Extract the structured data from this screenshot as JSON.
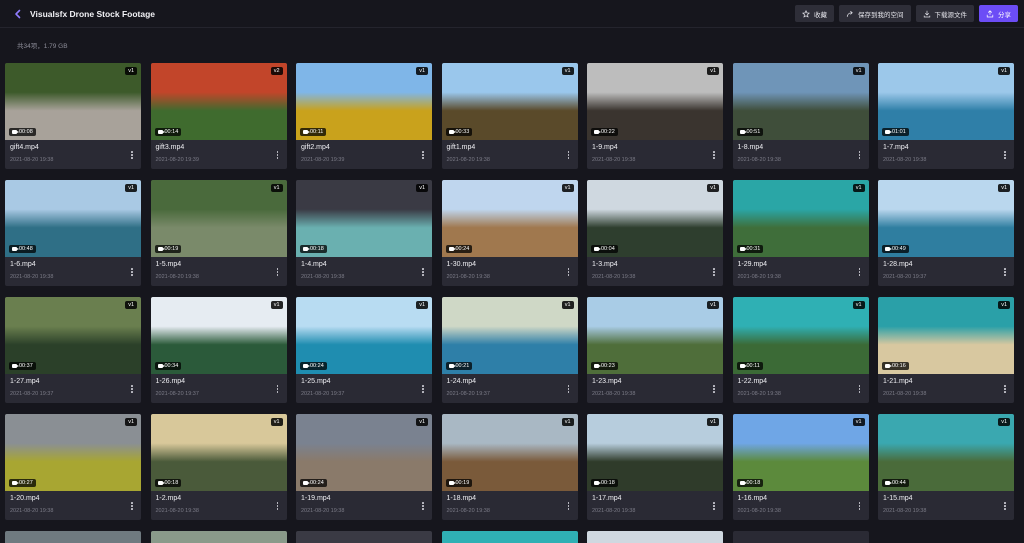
{
  "header": {
    "title": "Visualsfx Drone Stock Footage",
    "actions": [
      {
        "label": "收藏",
        "icon": "star-icon"
      },
      {
        "label": "保存到我的空间",
        "icon": "share-arrow-icon"
      },
      {
        "label": "下载源文件",
        "icon": "download-icon"
      },
      {
        "label": "分享",
        "icon": "share-icon"
      }
    ]
  },
  "meta": {
    "summary": "共34项，1.79 GB"
  },
  "videos": [
    {
      "name": "gift4.mp4",
      "date": "2021-08-20 19:38",
      "duration": "00:08",
      "version": "v1"
    },
    {
      "name": "gift3.mp4",
      "date": "2021-08-20 19:39",
      "duration": "00:14",
      "version": "v2"
    },
    {
      "name": "gift2.mp4",
      "date": "2021-08-20 19:39",
      "duration": "00:11",
      "version": "v1"
    },
    {
      "name": "gift1.mp4",
      "date": "2021-08-20 19:38",
      "duration": "00:33",
      "version": "v1"
    },
    {
      "name": "1-9.mp4",
      "date": "2021-08-20 19:38",
      "duration": "00:22",
      "version": "v1"
    },
    {
      "name": "1-8.mp4",
      "date": "2021-08-20 19:38",
      "duration": "00:51",
      "version": "v1"
    },
    {
      "name": "1-7.mp4",
      "date": "2021-08-20 19:38",
      "duration": "01:01",
      "version": "v1"
    },
    {
      "name": "1-6.mp4",
      "date": "2021-08-20 19:38",
      "duration": "00:48",
      "version": "v1"
    },
    {
      "name": "1-5.mp4",
      "date": "2021-08-20 19:38",
      "duration": "00:19",
      "version": "v1"
    },
    {
      "name": "1-4.mp4",
      "date": "2021-08-20 19:38",
      "duration": "00:18",
      "version": "v1"
    },
    {
      "name": "1-30.mp4",
      "date": "2021-08-20 19:38",
      "duration": "00:24",
      "version": "v1"
    },
    {
      "name": "1-3.mp4",
      "date": "2021-08-20 19:38",
      "duration": "00:04",
      "version": "v1"
    },
    {
      "name": "1-29.mp4",
      "date": "2021-08-20 19:38",
      "duration": "00:31",
      "version": "v1"
    },
    {
      "name": "1-28.mp4",
      "date": "2021-08-20 19:37",
      "duration": "00:49",
      "version": "v1"
    },
    {
      "name": "1-27.mp4",
      "date": "2021-08-20 19:37",
      "duration": "00:37",
      "version": "v1"
    },
    {
      "name": "1-26.mp4",
      "date": "2021-08-20 19:37",
      "duration": "00:34",
      "version": "v1"
    },
    {
      "name": "1-25.mp4",
      "date": "2021-08-20 19:37",
      "duration": "00:24",
      "version": "v1"
    },
    {
      "name": "1-24.mp4",
      "date": "2021-08-20 19:37",
      "duration": "00:21",
      "version": "v1"
    },
    {
      "name": "1-23.mp4",
      "date": "2021-08-20 19:38",
      "duration": "00:23",
      "version": "v1"
    },
    {
      "name": "1-22.mp4",
      "date": "2021-08-20 19:38",
      "duration": "00:11",
      "version": "v1"
    },
    {
      "name": "1-21.mp4",
      "date": "2021-08-20 19:38",
      "duration": "00:16",
      "version": "v1"
    },
    {
      "name": "1-20.mp4",
      "date": "2021-08-20 19:38",
      "duration": "00:27",
      "version": "v1"
    },
    {
      "name": "1-2.mp4",
      "date": "2021-08-20 19:38",
      "duration": "00:18",
      "version": "v1"
    },
    {
      "name": "1-19.mp4",
      "date": "2021-08-20 19:38",
      "duration": "00:24",
      "version": "v1"
    },
    {
      "name": "1-18.mp4",
      "date": "2021-08-20 19:38",
      "duration": "00:19",
      "version": "v1"
    },
    {
      "name": "1-17.mp4",
      "date": "2021-08-20 19:38",
      "duration": "00:18",
      "version": "v1"
    },
    {
      "name": "1-16.mp4",
      "date": "2021-08-20 19:38",
      "duration": "00:18",
      "version": "v1"
    },
    {
      "name": "1-15.mp4",
      "date": "2021-08-20 19:38",
      "duration": "00:44",
      "version": "v1"
    }
  ],
  "thumb_colors": [
    [
      "#3d5a2a",
      "#a8a29a"
    ],
    [
      "#c2452a",
      "#3f6b2e"
    ],
    [
      "#7fb6e8",
      "#c9a21c"
    ],
    [
      "#9ac7ec",
      "#5a4a2a"
    ],
    [
      "#bdbdbd",
      "#3a342f"
    ],
    [
      "#6f95b8",
      "#3f4e3a"
    ],
    [
      "#9cc8ea",
      "#2f7fa8"
    ],
    [
      "#a9c9e4",
      "#2f6f86"
    ],
    [
      "#4a6a3c",
      "#7a8a6a"
    ],
    [
      "#3a3a44",
      "#6ab0b0"
    ],
    [
      "#bfd6ee",
      "#a0784e"
    ],
    [
      "#cfd8e0",
      "#2e3e2e"
    ],
    [
      "#2aa6a6",
      "#3f6e3a"
    ],
    [
      "#bad7ee",
      "#2f7ea0"
    ],
    [
      "#6a7f4f",
      "#2b4029"
    ],
    [
      "#e6ecf2",
      "#2b5a3a"
    ],
    [
      "#b8dcf2",
      "#1f8db0"
    ],
    [
      "#cfd8c6",
      "#2e7fa8"
    ],
    [
      "#a9cce6",
      "#4f6e3a"
    ],
    [
      "#2fb0b4",
      "#3b6a36"
    ],
    [
      "#2aa0a8",
      "#d8c8a0"
    ],
    [
      "#8a8f94",
      "#a8a632"
    ],
    [
      "#d8c89a",
      "#4a5a3a"
    ],
    [
      "#7a8290",
      "#8a7a6a"
    ],
    [
      "#a9b8c4",
      "#7a5a3a"
    ],
    [
      "#b7cddd",
      "#2f3b2a"
    ],
    [
      "#6fa6e6",
      "#5c8a3c"
    ],
    [
      "#3aa8b0",
      "#4a6b3a"
    ]
  ],
  "stub_colors": [
    "#6f7a80",
    "#8a9a8a",
    "#3a3a44",
    "#2fb0b4",
    "#cfd8e0",
    "#2a2a34",
    "#5a6a4a"
  ]
}
